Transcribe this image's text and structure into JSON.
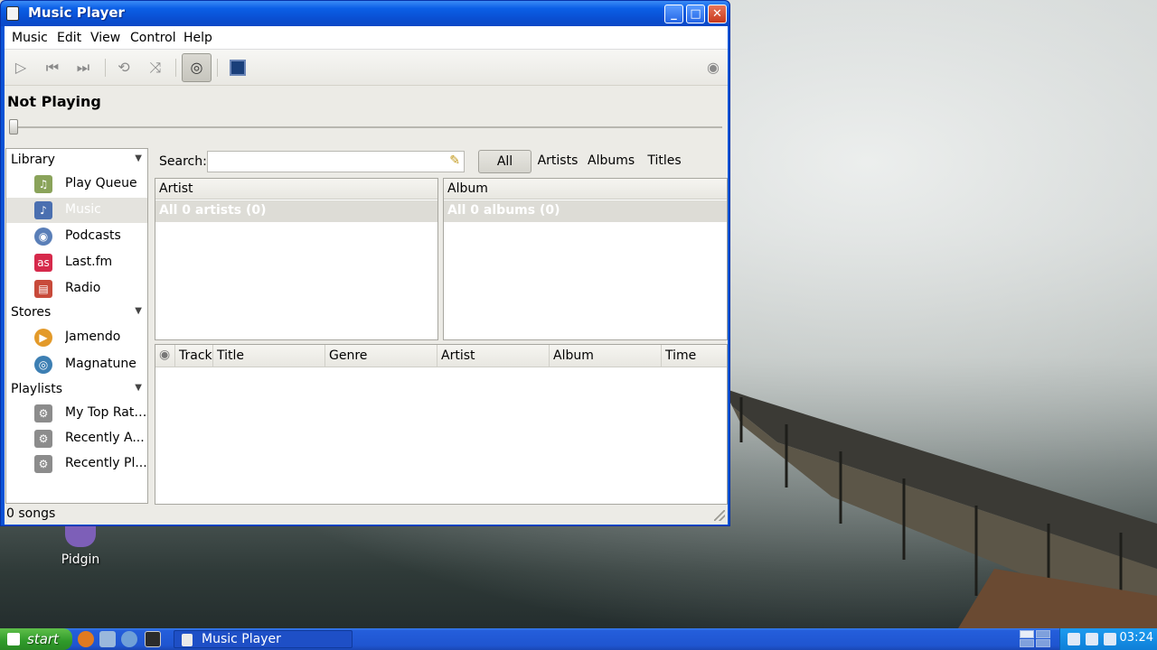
{
  "window": {
    "title": "Music Player",
    "buttons": {
      "minimize": "_",
      "maximize": "□",
      "close": "✕"
    }
  },
  "menu": [
    "Music",
    "Edit",
    "View",
    "Control",
    "Help"
  ],
  "toolbar": {
    "play_icon": "▷",
    "prev_icon": "⏮",
    "next_icon": "⏭",
    "repeat_icon": "⟲",
    "shuffle_icon": "⤨",
    "browse_icon": "◎",
    "visualizer_icon": "▣",
    "volume_icon": "◉"
  },
  "player": {
    "status": "Not Playing",
    "progress": 0
  },
  "sidebar": {
    "sections": [
      {
        "label": "Library"
      },
      {
        "label": "Stores"
      },
      {
        "label": "Playlists"
      }
    ],
    "items": [
      {
        "label": "Play Queue",
        "icon": "play-queue-icon",
        "glyph": "♫",
        "color": "#8aa35a"
      },
      {
        "label": "Music",
        "icon": "music-note-icon",
        "glyph": "♪",
        "color": "#4a6fb0"
      },
      {
        "label": "Podcasts",
        "icon": "podcast-icon",
        "glyph": "◉",
        "color": "#5a7fb8"
      },
      {
        "label": "Last.fm",
        "icon": "lastfm-icon",
        "glyph": "as",
        "color": "#d6294b"
      },
      {
        "label": "Radio",
        "icon": "radio-icon",
        "glyph": "▤",
        "color": "#c84a3a"
      },
      {
        "label": "Jamendo",
        "icon": "jamendo-icon",
        "glyph": "▶",
        "color": "#e39a2a"
      },
      {
        "label": "Magnatune",
        "icon": "magnatune-icon",
        "glyph": "◎",
        "color": "#3d7fb3"
      },
      {
        "label": "My Top Rated",
        "icon": "smart-playlist-icon",
        "glyph": "⚙",
        "color": "#8c8c8c"
      },
      {
        "label": "Recently A...",
        "icon": "smart-playlist-icon",
        "glyph": "⚙",
        "color": "#8c8c8c"
      },
      {
        "label": "Recently Pl...",
        "icon": "smart-playlist-icon",
        "glyph": "⚙",
        "color": "#8c8c8c"
      }
    ]
  },
  "search": {
    "label": "Search:",
    "value": "",
    "placeholder": "",
    "clear_icon": "✎"
  },
  "filters": [
    "All",
    "Artists",
    "Albums",
    "Titles"
  ],
  "browser": {
    "artist_header": "Artist",
    "artist_all": "All 0 artists (0)",
    "album_header": "Album",
    "album_all": "All 0 albums (0)"
  },
  "tracklist": {
    "columns": [
      "Track",
      "Title",
      "Genre",
      "Artist",
      "Album",
      "Time"
    ],
    "status_icon": "◉"
  },
  "status": {
    "text": "0 songs"
  },
  "desktop": {
    "icon_label": "Pidgin"
  },
  "taskbar": {
    "start_label": "start",
    "task_label": "Music Player",
    "clock": "03:24"
  },
  "colors": {
    "titlebar": "#0b5fe6",
    "selection": "#e4e3de",
    "taskbar": "#245edb",
    "start": "#2f9a2a"
  }
}
